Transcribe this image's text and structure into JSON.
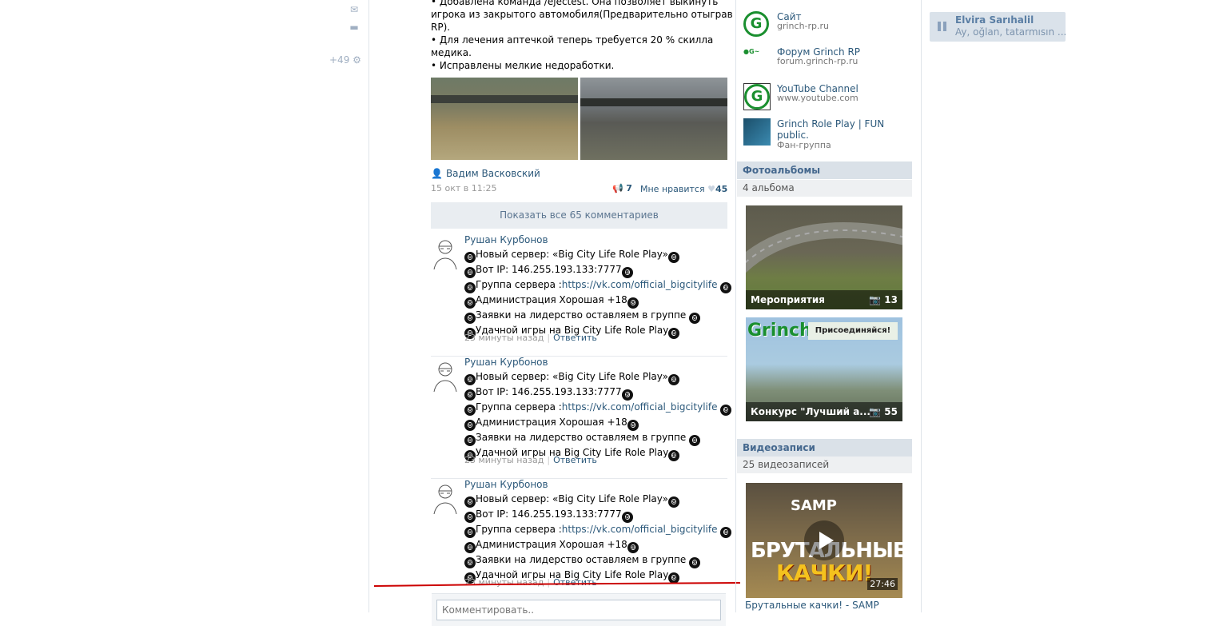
{
  "left_nav": {
    "badge_count": "+49"
  },
  "post": {
    "text_lines": [
      "• Добавлена команда /ejectest. Она позволяет выкинуть",
      "игрока из закрытого автомобиля(Предварительно отыграв",
      "RP).",
      "• Для лечения аптечкой теперь требуется 20 % скилла",
      "медика.",
      "• Исправлены мелкие недоработки."
    ],
    "author": "Вадим Васковский",
    "date": "15 окт в 11:25",
    "shares": "7",
    "like_label": "Мне нравится",
    "likes": "45",
    "show_all": "Показать все 65 комментариев"
  },
  "comments": [
    {
      "author": "Рушан Курбонов",
      "lines": [
        "Новый сервер: «Big City Life Role Play»",
        "Вот IP: 146.255.193.133:7777",
        "Группа сервера :",
        "Администрация Хорошая +18",
        "Заявки на лидерство оставляем в группе",
        "Удачной игры на Big City Life Role Play"
      ],
      "link": "https://vk.com/official_bigcitylife",
      "time": "23 минуты назад",
      "reply": "Ответить"
    },
    {
      "author": "Рушан Курбонов",
      "lines": [
        "Новый сервер: «Big City Life Role Play»",
        "Вот IP: 146.255.193.133:7777",
        "Группа сервера :",
        "Администрация Хорошая +18",
        "Заявки на лидерство оставляем в группе",
        "Удачной игры на Big City Life Role Play"
      ],
      "link": "https://vk.com/official_bigcitylife",
      "time": "23 минуты назад",
      "reply": "Ответить"
    },
    {
      "author": "Рушан Курбонов",
      "lines": [
        "Новый сервер: «Big City Life Role Play»",
        "Вот IP: 146.255.193.133:7777",
        "Группа сервера :",
        "Администрация Хорошая +18",
        "Заявки на лидерство оставляем в группе",
        "Удачной игры на Big City Life Role Play"
      ],
      "link": "https://vk.com/official_bigcitylife",
      "time": "23 минуты назад",
      "reply": "Ответить"
    }
  ],
  "comment_input": {
    "placeholder": "Комментировать.."
  },
  "sidebar": {
    "links": [
      {
        "title": "Сайт",
        "sub": "grinch-rp.ru"
      },
      {
        "title": "Форум Grinch RP",
        "sub": "forum.grinch-rp.ru"
      },
      {
        "title": "YouTube Channel",
        "sub": "www.youtube.com"
      },
      {
        "title": "Grinch Role Play | FUN public.",
        "sub": "Фан-группа"
      }
    ],
    "albums_head": "Фотоальбомы",
    "albums_count": "4 альбома",
    "albums": [
      {
        "title": "Мероприятия",
        "count": "13"
      },
      {
        "title": "Конкурс \"Лучший а...",
        "count": "55",
        "banner": "Присоединяйся!",
        "logo_text": "Grinch"
      }
    ],
    "videos_head": "Видеозаписи",
    "videos_count": "25 видеозаписей",
    "video": {
      "brand": "SAMP",
      "title_big": "БРУТАЛЬНЫЕ",
      "title_big2": "КАЧКИ!",
      "duration": "27:46",
      "caption": "Брутальные качки! - SAMP"
    }
  },
  "chat": {
    "name": "Elvira Sarıhalil",
    "message": "Ay, oğlan, tatarmısın ..."
  },
  "colors": {
    "link": "#2b587a",
    "section_head": "#dae1e8",
    "red_line": "#cc0000"
  }
}
